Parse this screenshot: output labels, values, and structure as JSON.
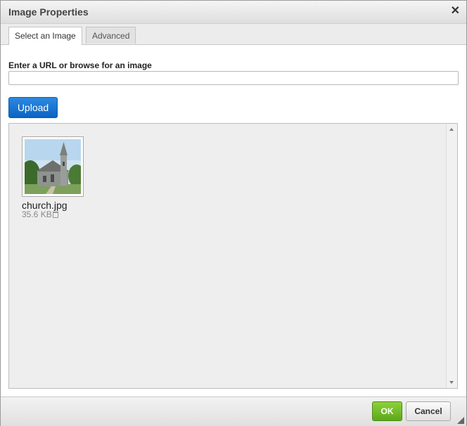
{
  "dialog": {
    "title": "Image Properties",
    "close_symbol": "✕"
  },
  "tabs": [
    {
      "label": "Select an Image",
      "active": true
    },
    {
      "label": "Advanced",
      "active": false
    }
  ],
  "url_field": {
    "label": "Enter a URL or browse for an image",
    "value": "",
    "placeholder": ""
  },
  "upload_button": {
    "label": "Upload"
  },
  "files": [
    {
      "name": "church.jpg",
      "size": "35.6 KB",
      "icon": "trash-icon"
    }
  ],
  "footer": {
    "ok_label": "OK",
    "cancel_label": "Cancel"
  },
  "colors": {
    "ok_green": "#6cb61f",
    "upload_blue": "#1470cc"
  }
}
